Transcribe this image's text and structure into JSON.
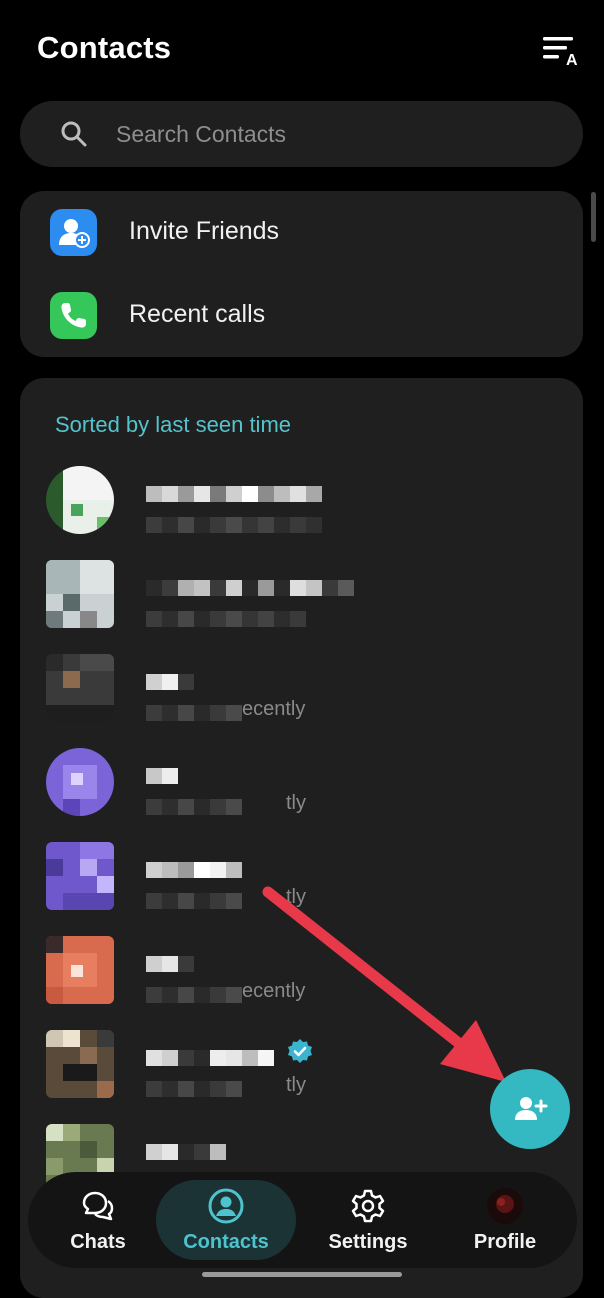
{
  "header": {
    "title": "Contacts",
    "sort_icon": "sort-alpha-icon"
  },
  "search": {
    "placeholder": "Search Contacts",
    "icon": "search-icon"
  },
  "quick_actions": [
    {
      "label": "Invite Friends",
      "icon": "add-user-icon",
      "color": "#2d8cf0"
    },
    {
      "label": "Recent calls",
      "icon": "phone-icon",
      "color": "#35c759"
    }
  ],
  "contacts_section": {
    "sort_label": "Sorted by last seen time",
    "contacts": [
      {
        "name": "",
        "status": ""
      },
      {
        "name": "",
        "status": ""
      },
      {
        "name": "",
        "status": "ecently"
      },
      {
        "name": "",
        "status": "tly"
      },
      {
        "name": "",
        "status": "tly"
      },
      {
        "name": "",
        "status": "ecently"
      },
      {
        "name": "",
        "status": "tly",
        "verified": true
      },
      {
        "name": "",
        "status": ""
      }
    ]
  },
  "fab": {
    "icon": "add-contact-icon"
  },
  "bottom_nav": [
    {
      "label": "Chats",
      "icon": "chat-icon",
      "active": false
    },
    {
      "label": "Contacts",
      "icon": "contact-icon",
      "active": true
    },
    {
      "label": "Settings",
      "icon": "gear-icon",
      "active": false
    },
    {
      "label": "Profile",
      "icon": "avatar",
      "active": false
    }
  ],
  "colors": {
    "accent": "#34b8c2",
    "annotation_arrow": "#e8394a"
  }
}
